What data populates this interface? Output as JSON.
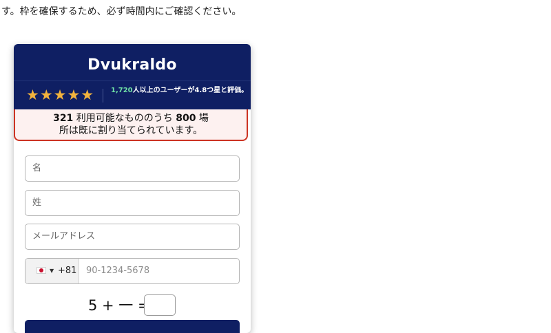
{
  "top_text": "す。枠を確保するため、必ず時間内にご確認ください。",
  "card": {
    "brand": "Dvukraldo",
    "stars": "★★★★★",
    "rating_count": "1,720",
    "rating_text": "人以上のユーザーが4.8つ星と評価。",
    "alert_line1_num1": "321",
    "alert_line1_mid": " 利用可能なもののうち ",
    "alert_line1_num2": "800",
    "alert_line1_end": " 場",
    "alert_line2": "所は既に割り当てられています。"
  },
  "form": {
    "first_name_placeholder": "名",
    "last_name_placeholder": "姓",
    "email_placeholder": "メールアドレス",
    "dial_code": "+81",
    "phone_placeholder": "90-1234-5678",
    "captcha_question": "5 + 一 ="
  },
  "colors": {
    "header_bg": "#0f1f63",
    "star": "#f2b33d",
    "rating_count": "#6fe0a5",
    "alert_border": "#cc3322"
  }
}
